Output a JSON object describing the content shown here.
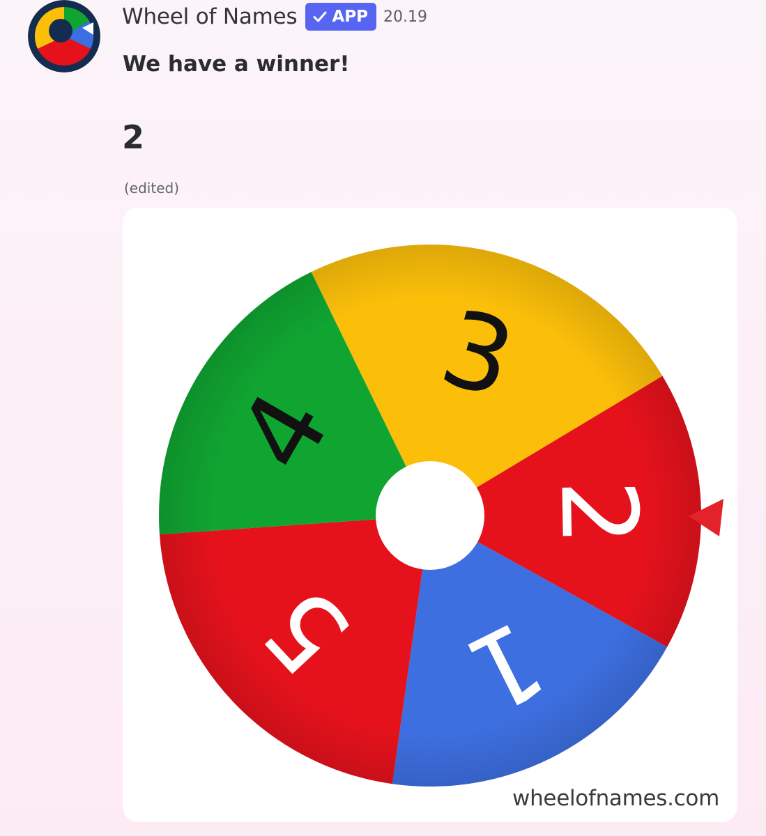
{
  "author": {
    "name": "Wheel of Names",
    "badge_label": "APP",
    "badge_icon": "checkmark-icon",
    "timestamp": "20.19",
    "avatar_icon": "wheel-logo-icon"
  },
  "message": {
    "headline": "We have a winner!",
    "winner": "2",
    "edited_label": "(edited)"
  },
  "wheel": {
    "segments": [
      {
        "label": "3",
        "color": "#fbbf0a"
      },
      {
        "label": "2",
        "color": "#e5121c"
      },
      {
        "label": "1",
        "color": "#3d6fe0"
      },
      {
        "label": "5",
        "color": "#e5121c"
      },
      {
        "label": "4",
        "color": "#10a431"
      }
    ],
    "pointer_color": "#e32229",
    "watermark": "wheelofnames.com"
  },
  "colors": {
    "brand_badge": "#5865f2",
    "background": "#fbf4f8"
  }
}
